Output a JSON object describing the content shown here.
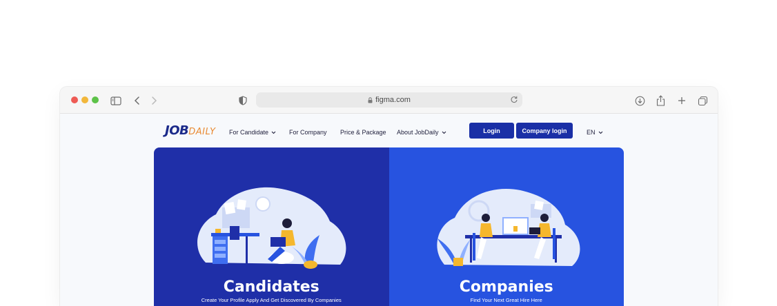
{
  "browser": {
    "url": "figma.com"
  },
  "site": {
    "logo": {
      "part1": "JOB",
      "part2": "DAILY"
    },
    "nav": [
      {
        "label": "For Candidate",
        "has_dropdown": true
      },
      {
        "label": "For Company",
        "has_dropdown": false
      },
      {
        "label": "Price & Package",
        "has_dropdown": false
      },
      {
        "label": "About JobDaily",
        "has_dropdown": true
      }
    ],
    "login_label": "Login",
    "company_login_label": "Company login",
    "language": "EN"
  },
  "hero": {
    "left": {
      "title": "Candidates",
      "subtitle": "Create Your Profile Apply And Get Discovered By Companies"
    },
    "right": {
      "title": "Companies",
      "subtitle": "Find Your Next Great Hire Here"
    }
  },
  "colors": {
    "brand_dark": "#1a2fa6",
    "left_panel": "#1f2fa8",
    "right_panel": "#2753e0",
    "accent_orange": "#e98b35"
  }
}
